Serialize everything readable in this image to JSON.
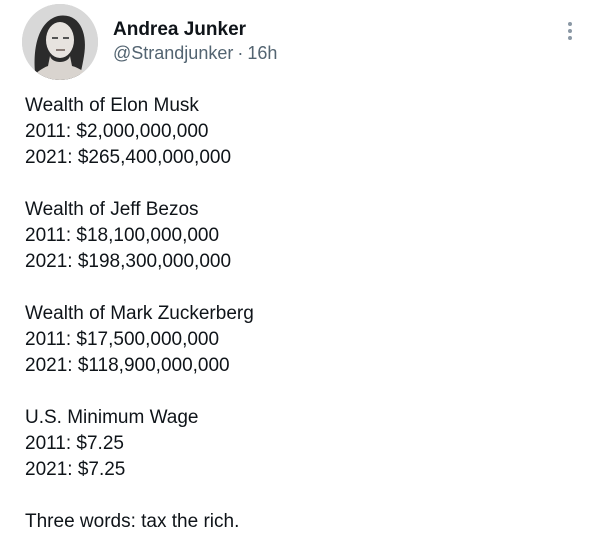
{
  "author": {
    "name": "Andrea Junker",
    "handle": "@Strandjunker",
    "separator": "·",
    "time": "16h",
    "avatar_icon": "profile-photo"
  },
  "more_icon": "more-options-icon",
  "content": {
    "musk": {
      "heading": "Wealth of Elon Musk",
      "y2011": "2011: $2,000,000,000",
      "y2021": "2021: $265,400,000,000"
    },
    "bezos": {
      "heading": "Wealth of Jeff Bezos",
      "y2011": "2011: $18,100,000,000",
      "y2021": "2021: $198,300,000,000"
    },
    "zuckerberg": {
      "heading": "Wealth of Mark Zuckerberg",
      "y2011": "2011: $17,500,000,000",
      "y2021": "2021: $118,900,000,000"
    },
    "wage": {
      "heading": "U.S. Minimum Wage",
      "y2011": "2011: $7.25",
      "y2021": "2021: $7.25"
    },
    "closing": "Three words: tax the rich."
  },
  "colors": {
    "text": "#0f1419",
    "secondary": "#536471",
    "icon": "#8b98a5"
  }
}
